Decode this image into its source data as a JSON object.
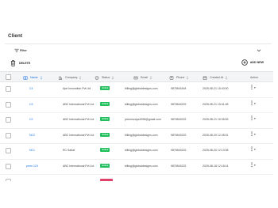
{
  "page": {
    "title": "Client"
  },
  "filter": {
    "label": "Filter",
    "icon": "filter-icon"
  },
  "toolbar": {
    "delete_label": "DELETE",
    "add_label": "ADD NEW"
  },
  "table": {
    "columns": [
      {
        "key": "name",
        "label": "Name",
        "icon": "person-icon"
      },
      {
        "key": "company",
        "label": "Company",
        "icon": "building-icon"
      },
      {
        "key": "status",
        "label": "Status",
        "icon": "shield-check-icon"
      },
      {
        "key": "email",
        "label": "Email",
        "icon": "email-icon"
      },
      {
        "key": "phone",
        "label": "Phone",
        "icon": "phone-icon"
      },
      {
        "key": "created_at",
        "label": "Created At",
        "icon": "calendar-icon"
      },
      {
        "key": "action",
        "label": "Action"
      }
    ],
    "rows": [
      {
        "name": "C4",
        "company": "Ape Innovation Pvt Ltd",
        "status": "Active",
        "email": "billing@globaldesigns.com",
        "phone": "9876543444",
        "created_at": "2025-08-21 15:43:00"
      },
      {
        "name": "C3",
        "company": "ABC International Pvt Ltd",
        "status": "Active",
        "email": "billing@globaldesigns.com",
        "phone": "9876543222",
        "created_at": "2025-08-21 15:41:45"
      },
      {
        "name": "C2",
        "company": "ABC International Pvt Ltd",
        "status": "Active",
        "email": "premmoriya1998@gmail.com",
        "phone": "9876543222",
        "created_at": "2025-08-21 15:35:53"
      },
      {
        "name": "NC2",
        "company": "ABC International Pvt Ltd",
        "status": "Active",
        "email": "billing@globaldesigns.com",
        "phone": "9876543222",
        "created_at": "2025-08-20 12:45:01"
      },
      {
        "name": "NC1",
        "company": "RC Sahat",
        "status": "Active",
        "email": "billing@globaldesigns.com",
        "phone": "9876543222",
        "created_at": "2025-08-20 12:13:08"
      },
      {
        "name": "prem 123",
        "company": "ABC International Pvt Ltd",
        "status": "Active",
        "email": "billing@globaldesigns.com",
        "phone": "9876543222",
        "created_at": "2025-08-18 12:18:14"
      }
    ]
  },
  "colors": {
    "accent": "#1a73e8",
    "active_badge": "#1fbf5b",
    "inactive_badge": "#e0406a",
    "header_bg": "#f3f4f6"
  }
}
